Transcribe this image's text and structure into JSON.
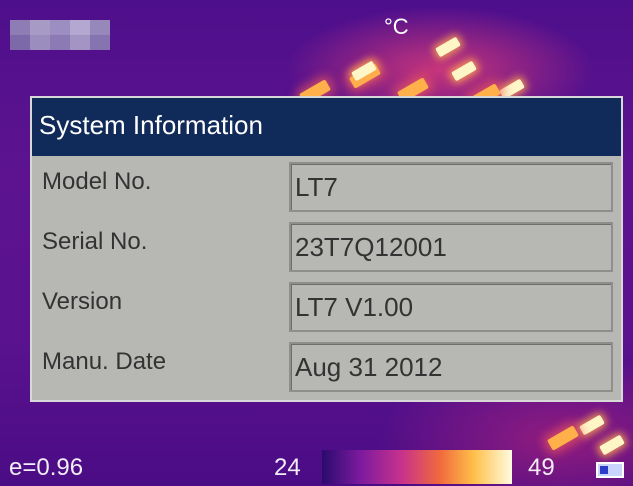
{
  "header": {
    "temp_unit": "°C"
  },
  "dialog": {
    "title": "System Information",
    "rows": [
      {
        "label": "Model No.",
        "value": "LT7"
      },
      {
        "label": "Serial No.",
        "value": "23T7Q12001"
      },
      {
        "label": "Version",
        "value": "LT7 V1.00"
      },
      {
        "label": "Manu. Date",
        "value": "Aug 31 2012"
      }
    ]
  },
  "status_bar": {
    "emissivity": "e=0.96",
    "scale_min": "24",
    "scale_max": "49",
    "icon": "battery-icon"
  },
  "colors": {
    "title_bar": "#102a5a",
    "dialog_bg": "#b7b8b4",
    "background": "#5a1290"
  }
}
